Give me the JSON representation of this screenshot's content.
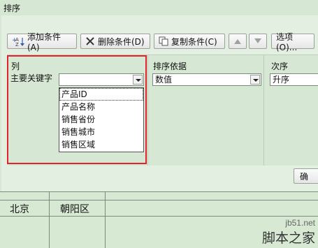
{
  "dialog": {
    "title": "排序",
    "toolbar": {
      "add_label": "添加条件(A)",
      "delete_label": "删除条件(D)",
      "copy_label": "复制条件(C)",
      "options_label": "选项(O)..."
    },
    "headers": {
      "column": "列",
      "sort_on": "排序依据",
      "order": "次序"
    },
    "row": {
      "key_label": "主要关键字",
      "sort_on_value": "数值",
      "order_value": "升序"
    },
    "dropdown_options": [
      "产品ID",
      "产品名称",
      "销售省份",
      "销售城市",
      "销售区域"
    ],
    "ok_partial": "确"
  },
  "sheet": {
    "cells": [
      "北京",
      "朝阳区"
    ]
  },
  "watermark": {
    "url": "jb51.net",
    "name": "脚本之家"
  },
  "colors": {
    "highlight": "#e3232b",
    "dialog_bg": "#d6e7d3"
  }
}
